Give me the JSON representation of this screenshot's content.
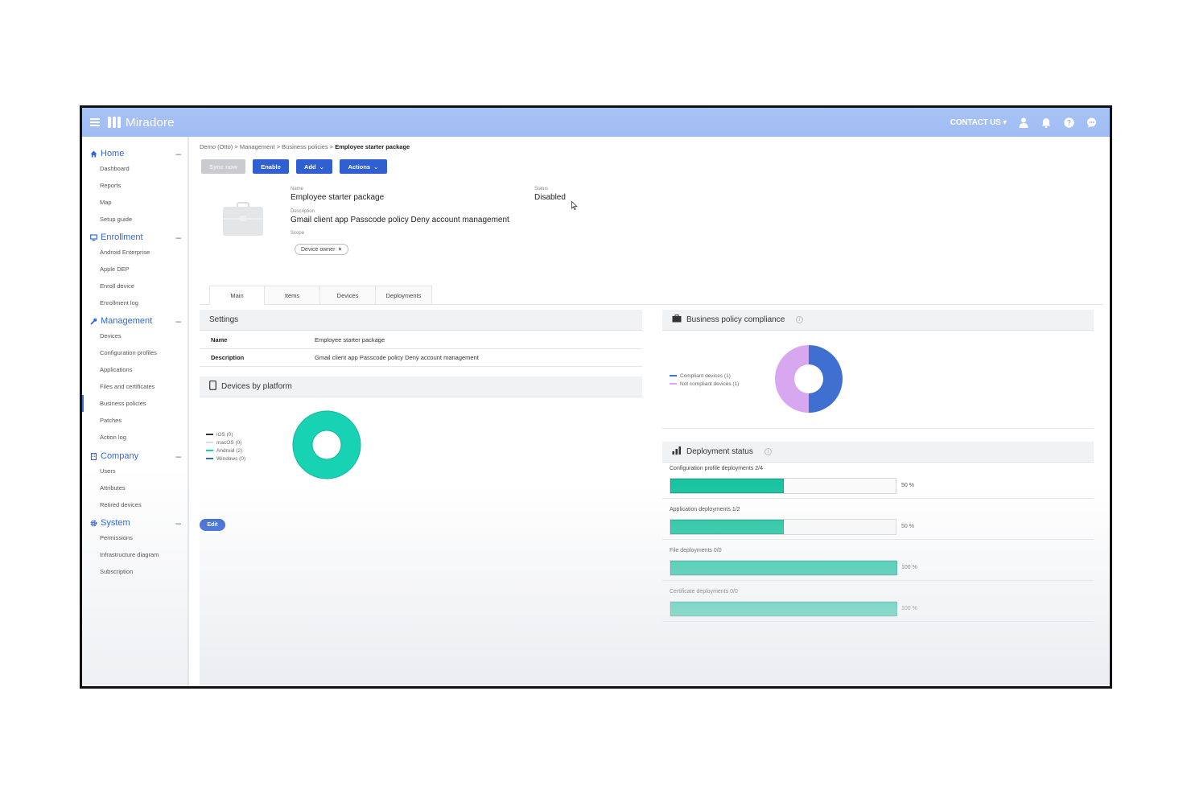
{
  "app": {
    "name": "Miradore"
  },
  "topbar": {
    "contact_label": "CONTACT US",
    "icons": [
      "user-icon",
      "bell-icon",
      "help-icon",
      "chat-icon"
    ]
  },
  "sidebar": {
    "sections": [
      {
        "label": "Home",
        "icon": "home-icon",
        "items": [
          "Dashboard",
          "Reports",
          "Map",
          "Setup guide"
        ]
      },
      {
        "label": "Enrollment",
        "icon": "monitor-icon",
        "items": [
          "Android Enterprise",
          "Apple DEP",
          "Enroll device",
          "Enrollment log"
        ]
      },
      {
        "label": "Management",
        "icon": "wrench-icon",
        "items": [
          "Devices",
          "Configuration profiles",
          "Applications",
          "Files and certificates",
          "Business policies",
          "Patches",
          "Action log"
        ]
      },
      {
        "label": "Company",
        "icon": "building-icon",
        "items": [
          "Users",
          "Attributes",
          "Retired devices"
        ]
      },
      {
        "label": "System",
        "icon": "gear-icon",
        "items": [
          "Permissions",
          "Infrastructure diagram",
          "Subscription"
        ]
      }
    ],
    "active_item": "Business policies"
  },
  "breadcrumb": [
    "Demo (Otto)",
    "Management",
    "Business policies",
    "Employee starter package"
  ],
  "toolbar": {
    "sync_label": "Sync now",
    "enable_label": "Enable",
    "add_label": "Add",
    "actions_label": "Actions"
  },
  "policy": {
    "name_label": "Name",
    "name": "Employee starter package",
    "status_label": "Status",
    "status": "Disabled",
    "description_label": "Description",
    "description": "Gmail client app Passcode policy Deny account management",
    "scope_label": "Scope",
    "scope_chip": "Device owner"
  },
  "tabs": [
    "Main",
    "Items",
    "Devices",
    "Deployments"
  ],
  "settings": {
    "title": "Settings",
    "rows": [
      {
        "key": "Name",
        "value": "Employee starter package"
      },
      {
        "key": "Description",
        "value": "Gmail client app Passcode policy Deny account management"
      }
    ]
  },
  "devices_by_platform": {
    "title": "Devices by platform",
    "legend": [
      {
        "label": "iOS (0)",
        "color": "#333333"
      },
      {
        "label": "macOS (0)",
        "color": "#dddddd"
      },
      {
        "label": "Android (2)",
        "color": "#17d3b4"
      },
      {
        "label": "Windows (0)",
        "color": "#3a66c4"
      }
    ]
  },
  "edit_label": "Edit",
  "compliance": {
    "title": "Business policy compliance",
    "legend": [
      {
        "label": "Compliant devices (1)",
        "color": "#3f6fd0"
      },
      {
        "label": "Not compliant devices (1)",
        "color": "#d7a8f0"
      }
    ]
  },
  "deployment_status": {
    "title": "Deployment status",
    "rows": [
      {
        "label": "Configuration profile deployments 2/4",
        "percent": 50,
        "percent_label": "50 %"
      },
      {
        "label": "Application deployments 1/2",
        "percent": 50,
        "percent_label": "50 %"
      },
      {
        "label": "File deployments 0/0",
        "percent": 100,
        "percent_label": "100 %"
      },
      {
        "label": "Certificate deployments 0/0",
        "percent": 100,
        "percent_label": "100 %"
      }
    ]
  }
}
